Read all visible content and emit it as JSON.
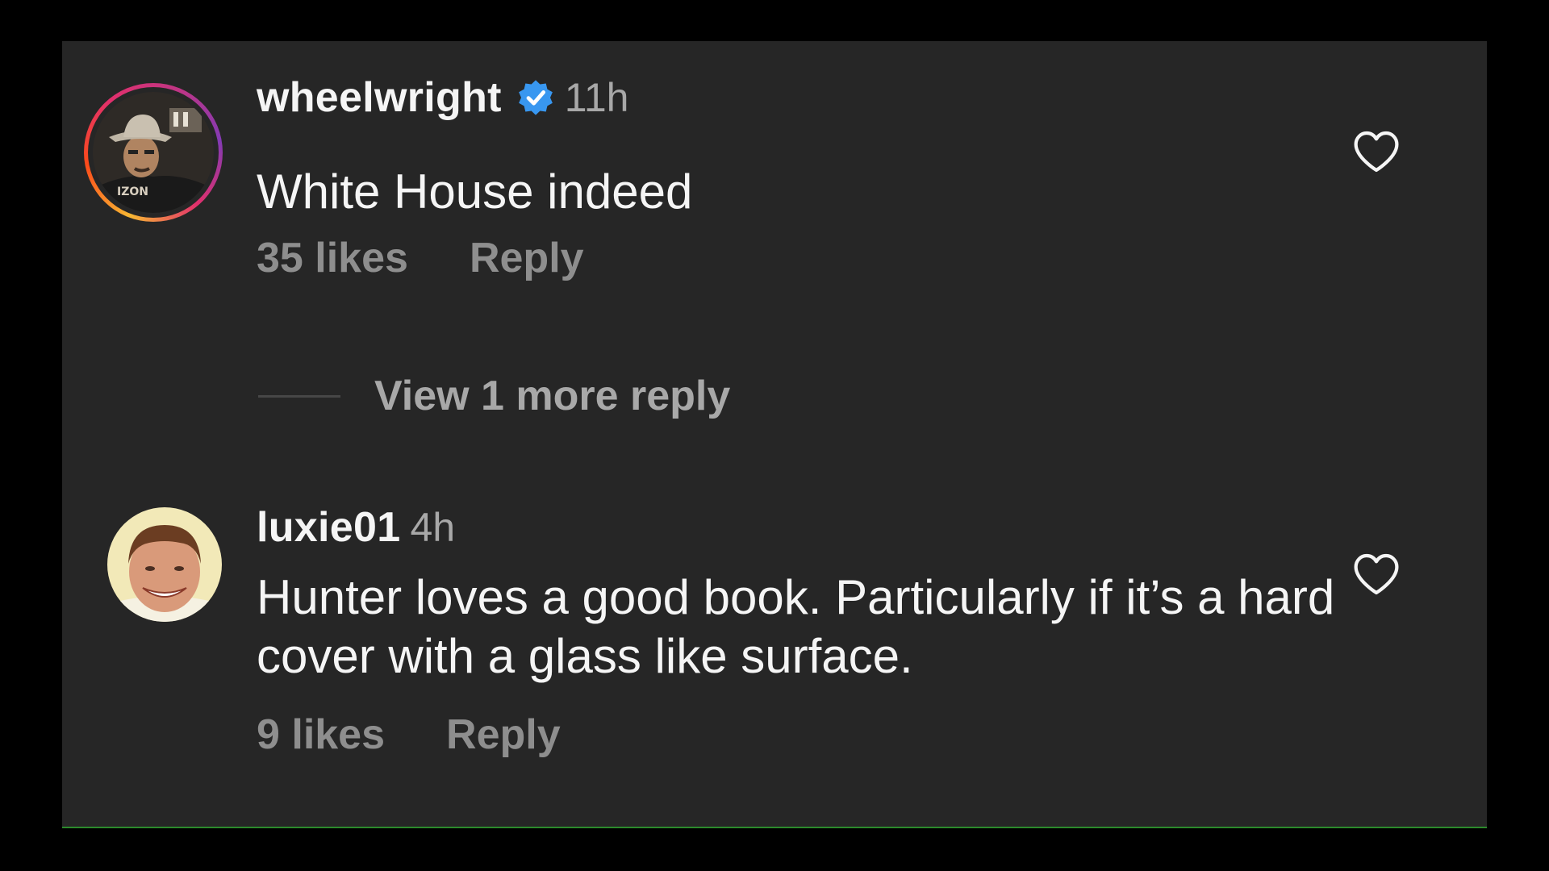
{
  "comments": [
    {
      "username": "wheelwright",
      "verified": true,
      "time": "11h",
      "text": "White House indeed",
      "likes": "35 likes",
      "reply_label": "Reply",
      "avatar": "avatar-man-cowboy-hat",
      "has_story_ring": true
    },
    {
      "username": "luxie01",
      "verified": false,
      "time": "4h",
      "text": "Hunter loves a good book. Particularly if it’s a hard cover with a glass like surface.",
      "likes": "9 likes",
      "reply_label": "Reply",
      "avatar": "avatar-smiling-man",
      "has_story_ring": false
    }
  ],
  "view_replies": {
    "label": "View 1 more reply"
  },
  "icons": {
    "like": "heart-outline-icon",
    "verified": "verified-badge-icon"
  },
  "colors": {
    "background": "#262626",
    "outer": "#000000",
    "primary_text": "#f5f5f5",
    "secondary_text": "#8e8e8e",
    "verified_blue": "#3897f0"
  }
}
